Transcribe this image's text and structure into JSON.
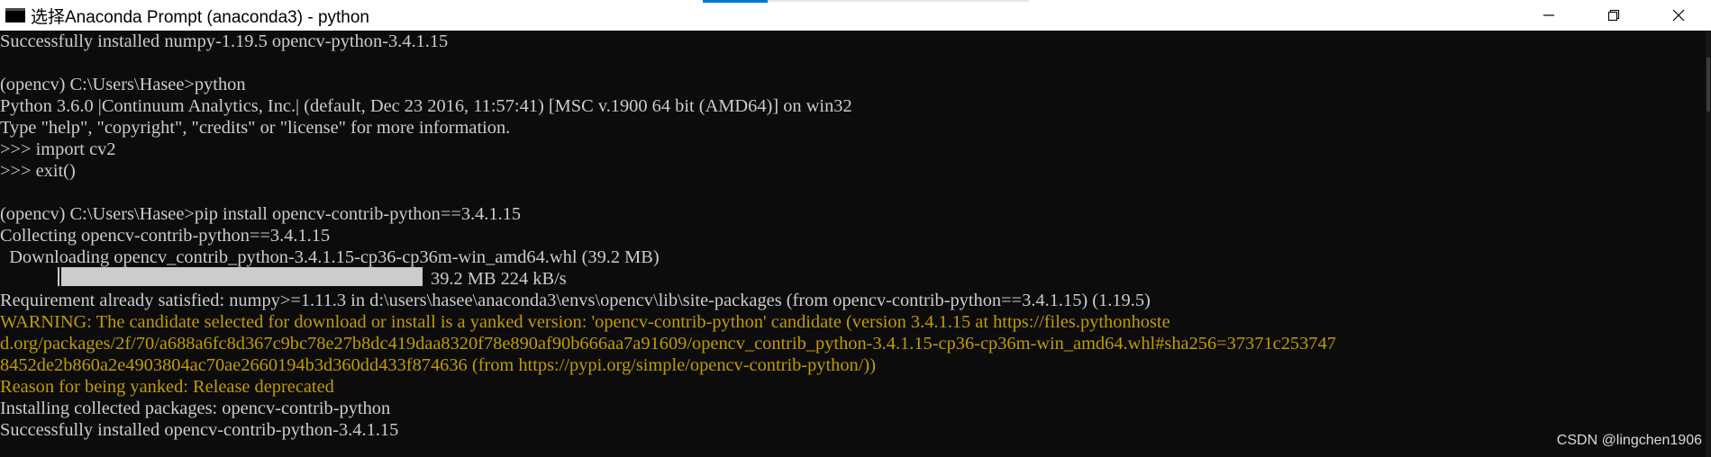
{
  "window": {
    "title": "选择Anaconda Prompt (anaconda3) - python",
    "icon": "console-window-icon",
    "controls": [
      "minimize-icon",
      "restore-icon",
      "close-icon"
    ]
  },
  "console": {
    "lines": [
      {
        "text": "Successfully installed numpy-1.19.5 opencv-python-3.4.1.15",
        "style": "normal"
      },
      {
        "text": "",
        "style": "normal"
      },
      {
        "text": "(opencv) C:\\Users\\Hasee>python",
        "style": "normal"
      },
      {
        "text": "Python 3.6.0 |Continuum Analytics, Inc.| (default, Dec 23 2016, 11:57:41) [MSC v.1900 64 bit (AMD64)] on win32",
        "style": "normal"
      },
      {
        "text": "Type \"help\", \"copyright\", \"credits\" or \"license\" for more information.",
        "style": "normal"
      },
      {
        "text": ">>> import cv2",
        "style": "normal"
      },
      {
        "text": ">>> exit()",
        "style": "normal"
      },
      {
        "text": "",
        "style": "normal"
      },
      {
        "text": "(opencv) C:\\Users\\Hasee>pip install opencv-contrib-python==3.4.1.15",
        "style": "normal"
      },
      {
        "text": "Collecting opencv-contrib-python==3.4.1.15",
        "style": "normal"
      },
      {
        "text": "  Downloading opencv_contrib_python-3.4.1.15-cp36-cp36m-win_amd64.whl (39.2 MB)",
        "style": "normal"
      },
      {
        "text": "39.2 MB 224 kB/s",
        "style": "progress"
      },
      {
        "text": "Requirement already satisfied: numpy>=1.11.3 in d:\\users\\hasee\\anaconda3\\envs\\opencv\\lib\\site-packages (from opencv-contrib-python==3.4.1.15) (1.19.5)",
        "style": "normal"
      },
      {
        "text": "WARNING: The candidate selected for download or install is a yanked version: 'opencv-contrib-python' candidate (version 3.4.1.15 at https://files.pythonhoste",
        "style": "warning"
      },
      {
        "text": "d.org/packages/2f/70/a688a6fc8d367c9bc78e27b8dc419daa8320f78e890af90b666aa7a91609/opencv_contrib_python-3.4.1.15-cp36-cp36m-win_amd64.whl#sha256=37371c253747",
        "style": "warning"
      },
      {
        "text": "8452de2b860a2e4903804ac70ae2660194b3d360dd433f874636 (from https://pypi.org/simple/opencv-contrib-python/))",
        "style": "warning"
      },
      {
        "text": "Reason for being yanked: Release deprecated",
        "style": "warning"
      },
      {
        "text": "Installing collected packages: opencv-contrib-python",
        "style": "normal"
      },
      {
        "text": "Successfully installed opencv-contrib-python-3.4.1.15",
        "style": "normal"
      }
    ],
    "progress": {
      "fraction": 1.0
    }
  },
  "watermark": "CSDN @lingchen1906",
  "colors": {
    "background": "#0c0c0c",
    "text": "#cccccc",
    "warning": "#c19c00",
    "titlebar": "#ffffff"
  }
}
